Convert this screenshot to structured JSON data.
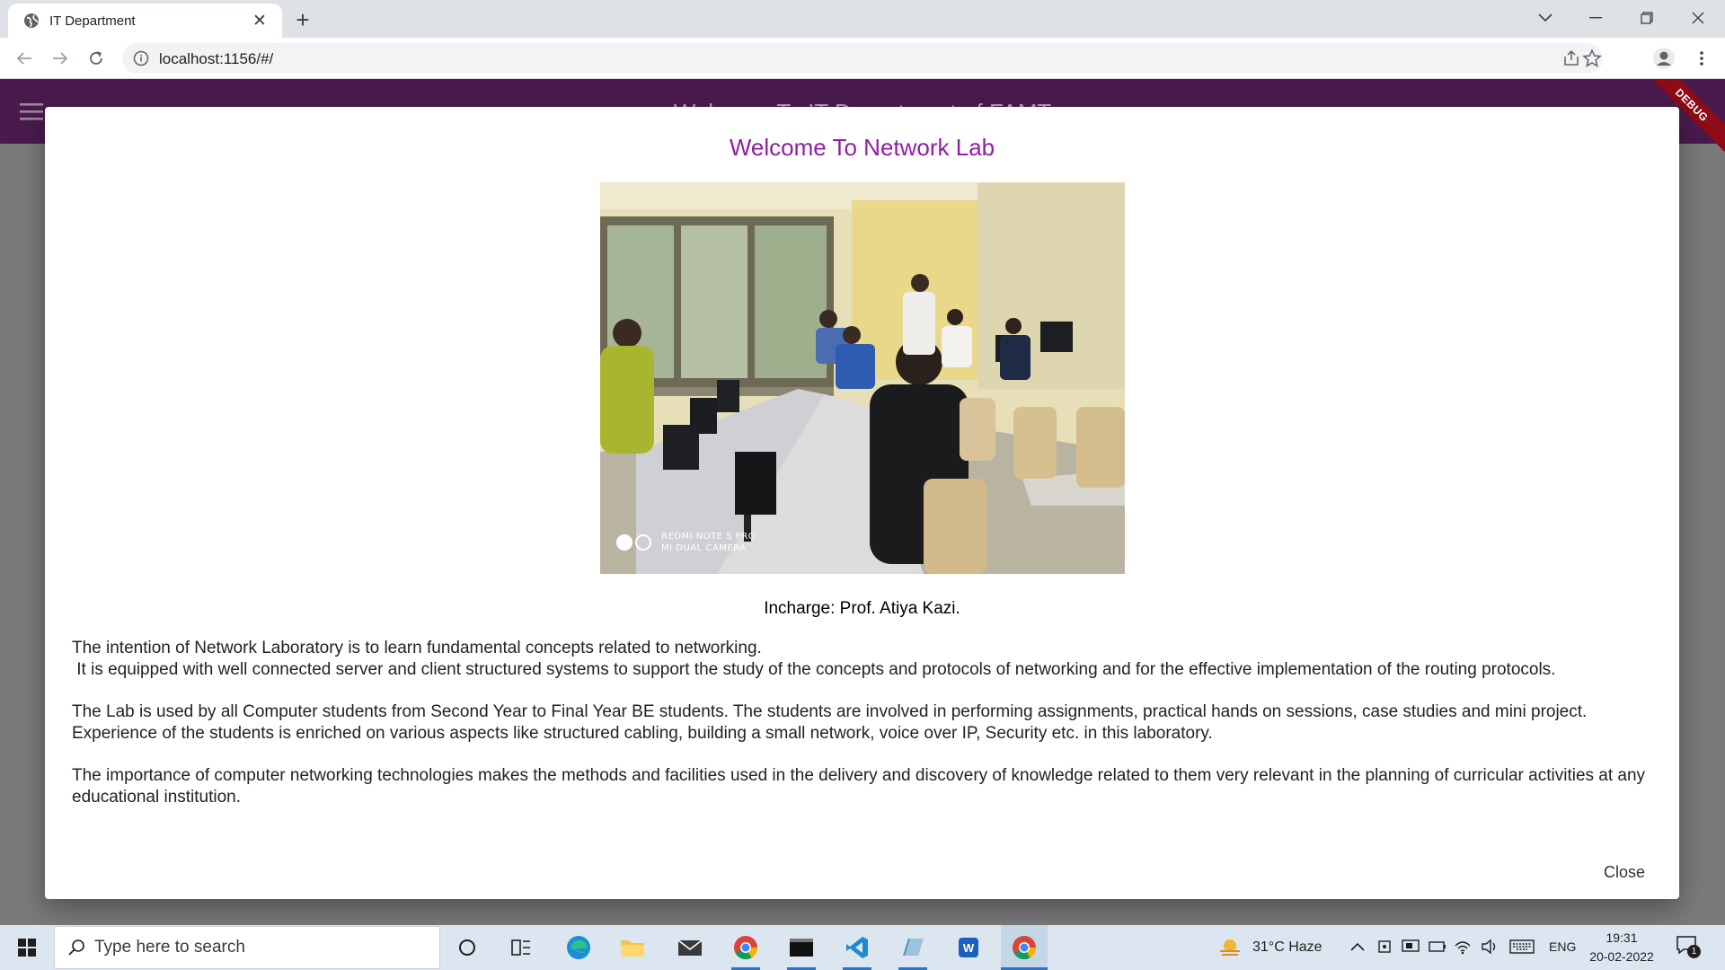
{
  "browser": {
    "tab_title": "IT Department",
    "url": "localhost:1156/#/"
  },
  "app": {
    "title": "Welcome To IT Department of FAMT",
    "debug_label": "DEBUG"
  },
  "dialog": {
    "title": "Welcome To Network Lab",
    "photo_watermark_line1": "REDMI NOTE 5 PRO",
    "photo_watermark_line2": "MI DUAL CAMERA",
    "incharge": "Incharge: Prof. Atiya Kazi.",
    "paragraph1": "The intention of Network Laboratory is to learn fundamental concepts related to networking.\n It is equipped with well connected server and client structured systems to support the study of the concepts and protocols of networking and for the effective implementation of the routing protocols.",
    "paragraph2": "The Lab is used by all Computer students from Second Year to Final Year BE students. The students are involved in performing assignments, practical hands on sessions, case studies and mini project. Experience of the students is enriched on various aspects like structured cabling, building a small network, voice over IP, Security etc. in this laboratory.",
    "paragraph3": "The importance of computer networking technologies makes the methods and facilities used in the delivery and discovery of knowledge related to them very relevant in the planning of curricular activities at any educational institution.",
    "close_label": "Close"
  },
  "taskbar": {
    "search_placeholder": "Type here to search",
    "weather": "31°C  Haze",
    "language": "ENG",
    "time": "19:31",
    "date": "20-02-2022",
    "notification_count": "1"
  },
  "colors": {
    "appbar": "#4a1a4d",
    "dialog_title": "#8e1fa3",
    "debug_ribbon": "#8c0b16"
  }
}
